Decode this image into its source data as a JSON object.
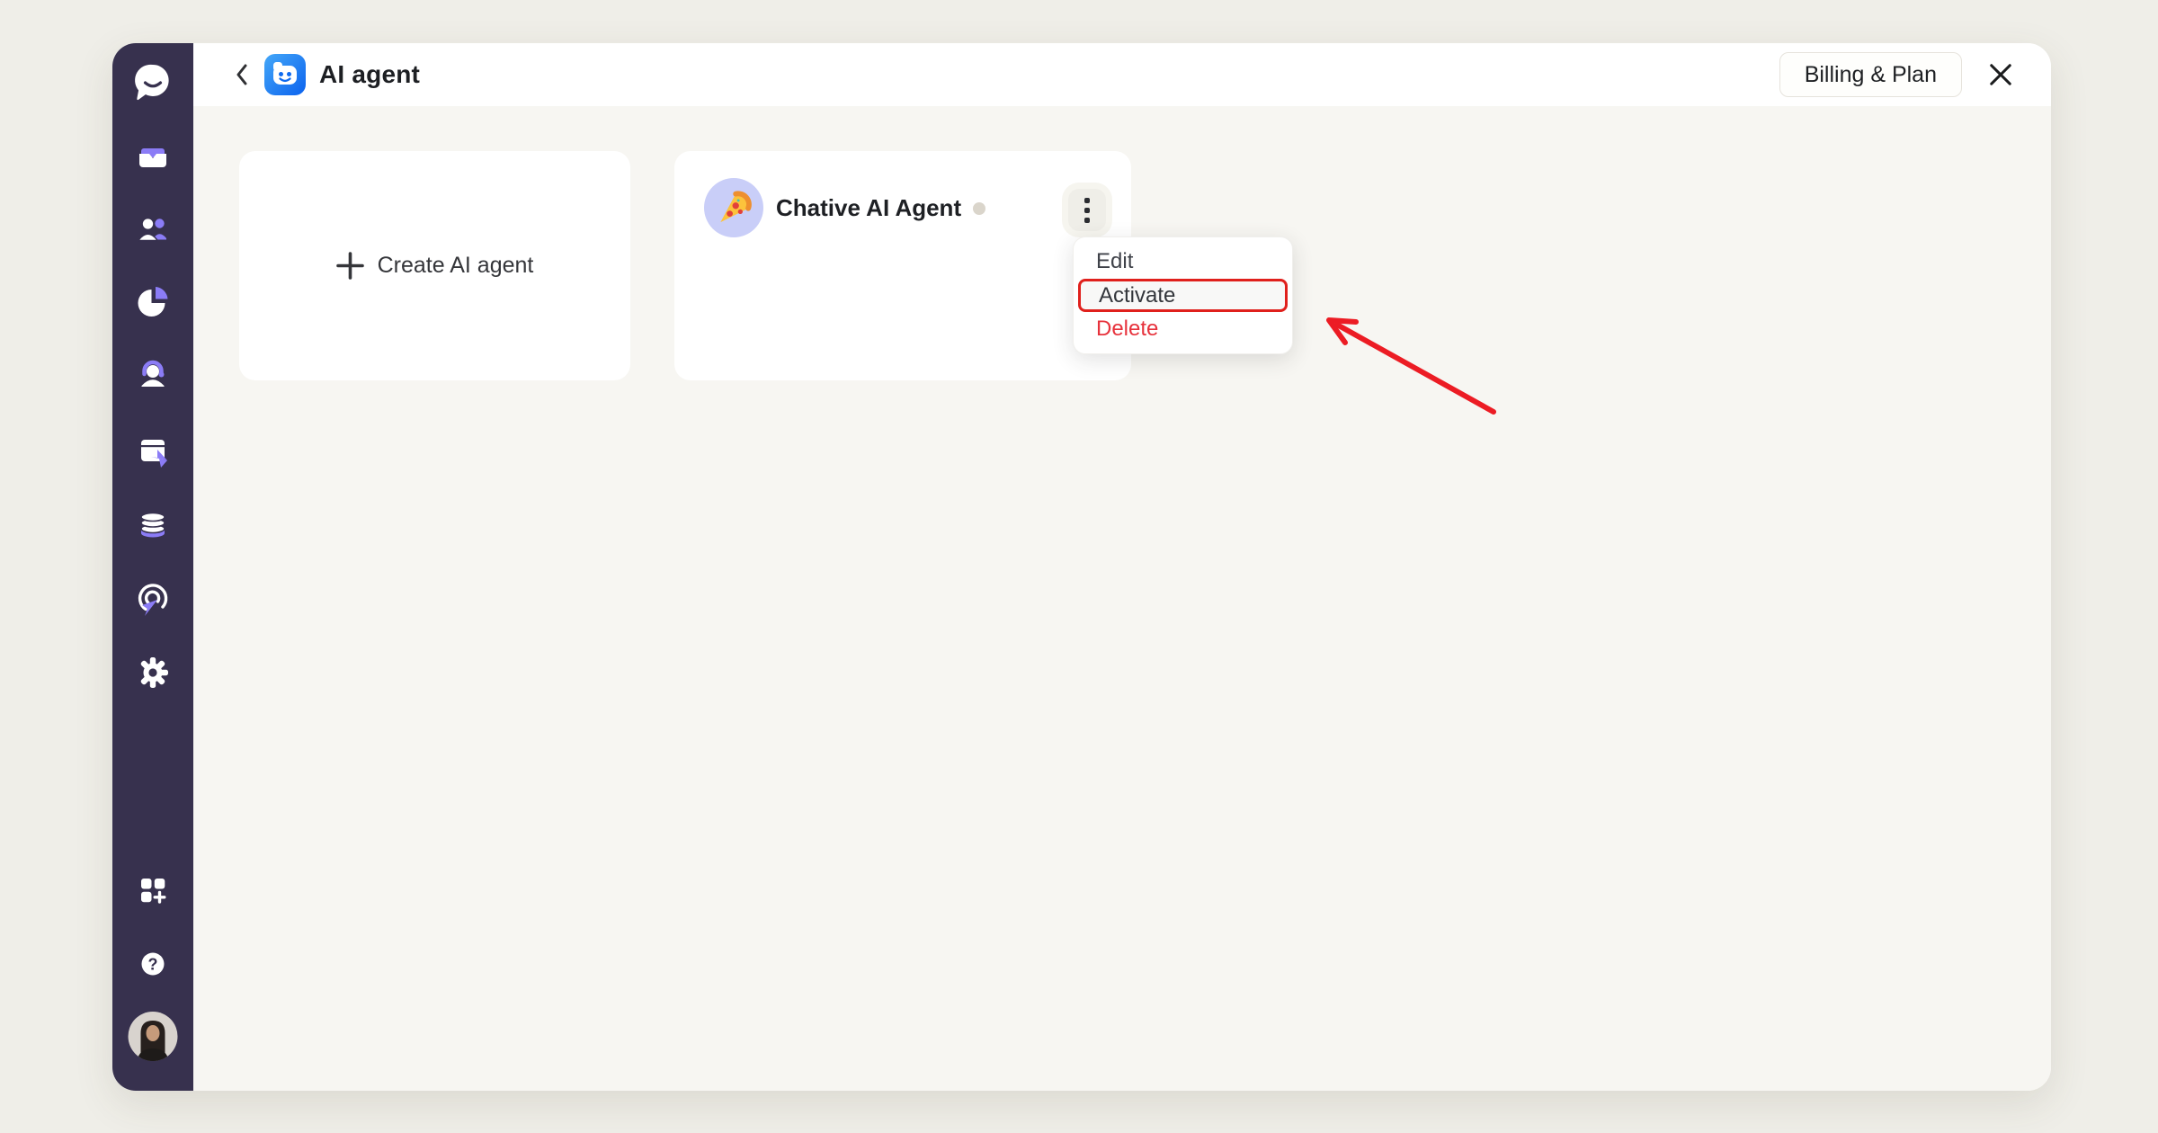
{
  "header": {
    "title": "AI agent",
    "billing_label": "Billing & Plan"
  },
  "create_card": {
    "label": "Create AI agent"
  },
  "agent_card": {
    "name": "Chative AI Agent",
    "status": "inactive"
  },
  "context_menu": {
    "items": [
      {
        "label": "Edit"
      },
      {
        "label": "Activate",
        "highlighted": true
      },
      {
        "label": "Delete",
        "danger": true
      }
    ]
  },
  "sidebar": {
    "icons": [
      "chat-logo",
      "inbox",
      "contacts",
      "reports",
      "live-agent",
      "campaigns",
      "data",
      "automation",
      "settings",
      "apps",
      "help",
      "profile"
    ]
  },
  "colors": {
    "outer_background": "#efeee8",
    "canvas_background": "#f7f6f2",
    "sidebar_background": "#37314e",
    "accent_purple": "#8b7cf6",
    "brand_blue": "#1677f3",
    "danger_red": "#e7323c",
    "highlight_border_red": "#e0201c",
    "annotation_arrow_red": "#ec1c24",
    "status_dot": "#dad5cb"
  }
}
